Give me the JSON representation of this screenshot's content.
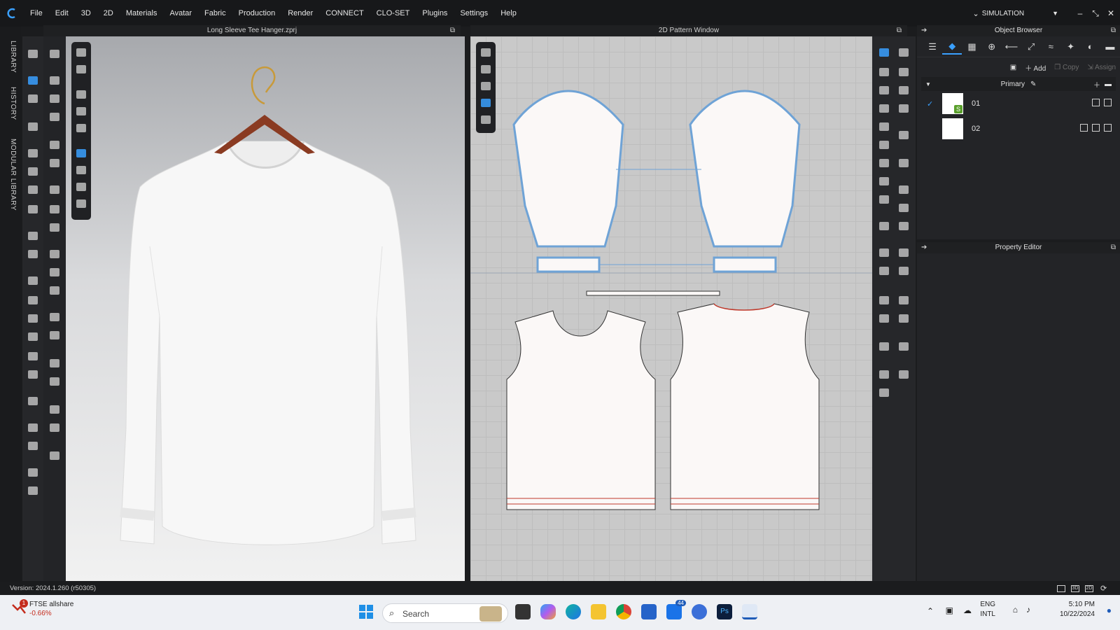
{
  "menu": {
    "items": [
      "File",
      "Edit",
      "3D",
      "2D",
      "Materials",
      "Avatar",
      "Fabric",
      "Production",
      "Render",
      "CONNECT",
      "CLO-SET",
      "Plugins",
      "Settings",
      "Help"
    ],
    "mode": "SIMULATION"
  },
  "sidetabs": [
    "LIBRARY",
    "HISTORY",
    "MODULAR LIBRARY"
  ],
  "window3d": {
    "title": "Long Sleeve Tee Hanger.zprj"
  },
  "window2d": {
    "title": "2D Pattern Window"
  },
  "object_browser": {
    "title": "Object Browser",
    "actions": {
      "add": "Add",
      "copy": "Copy",
      "assign": "Assign"
    },
    "group": "Primary",
    "materials": [
      {
        "name": "01",
        "checked": true
      },
      {
        "name": "02",
        "checked": false
      }
    ]
  },
  "property_editor": {
    "title": "Property Editor"
  },
  "status": {
    "version": "Version: 2024.1.260 (r50305)"
  },
  "taskbar": {
    "widget_name": "FTSE allshare",
    "widget_change": "-0.66%",
    "widget_badge": "1",
    "search_placeholder": "Search",
    "mail_badge": "44",
    "lang_top": "ENG",
    "lang_bottom": "INTL",
    "time": "5:10 PM",
    "date": "10/22/2024"
  },
  "colors": {
    "accent": "#3aa0ff",
    "pattern_outline": "#6fa3d6",
    "stitch_red": "#c0392b"
  }
}
